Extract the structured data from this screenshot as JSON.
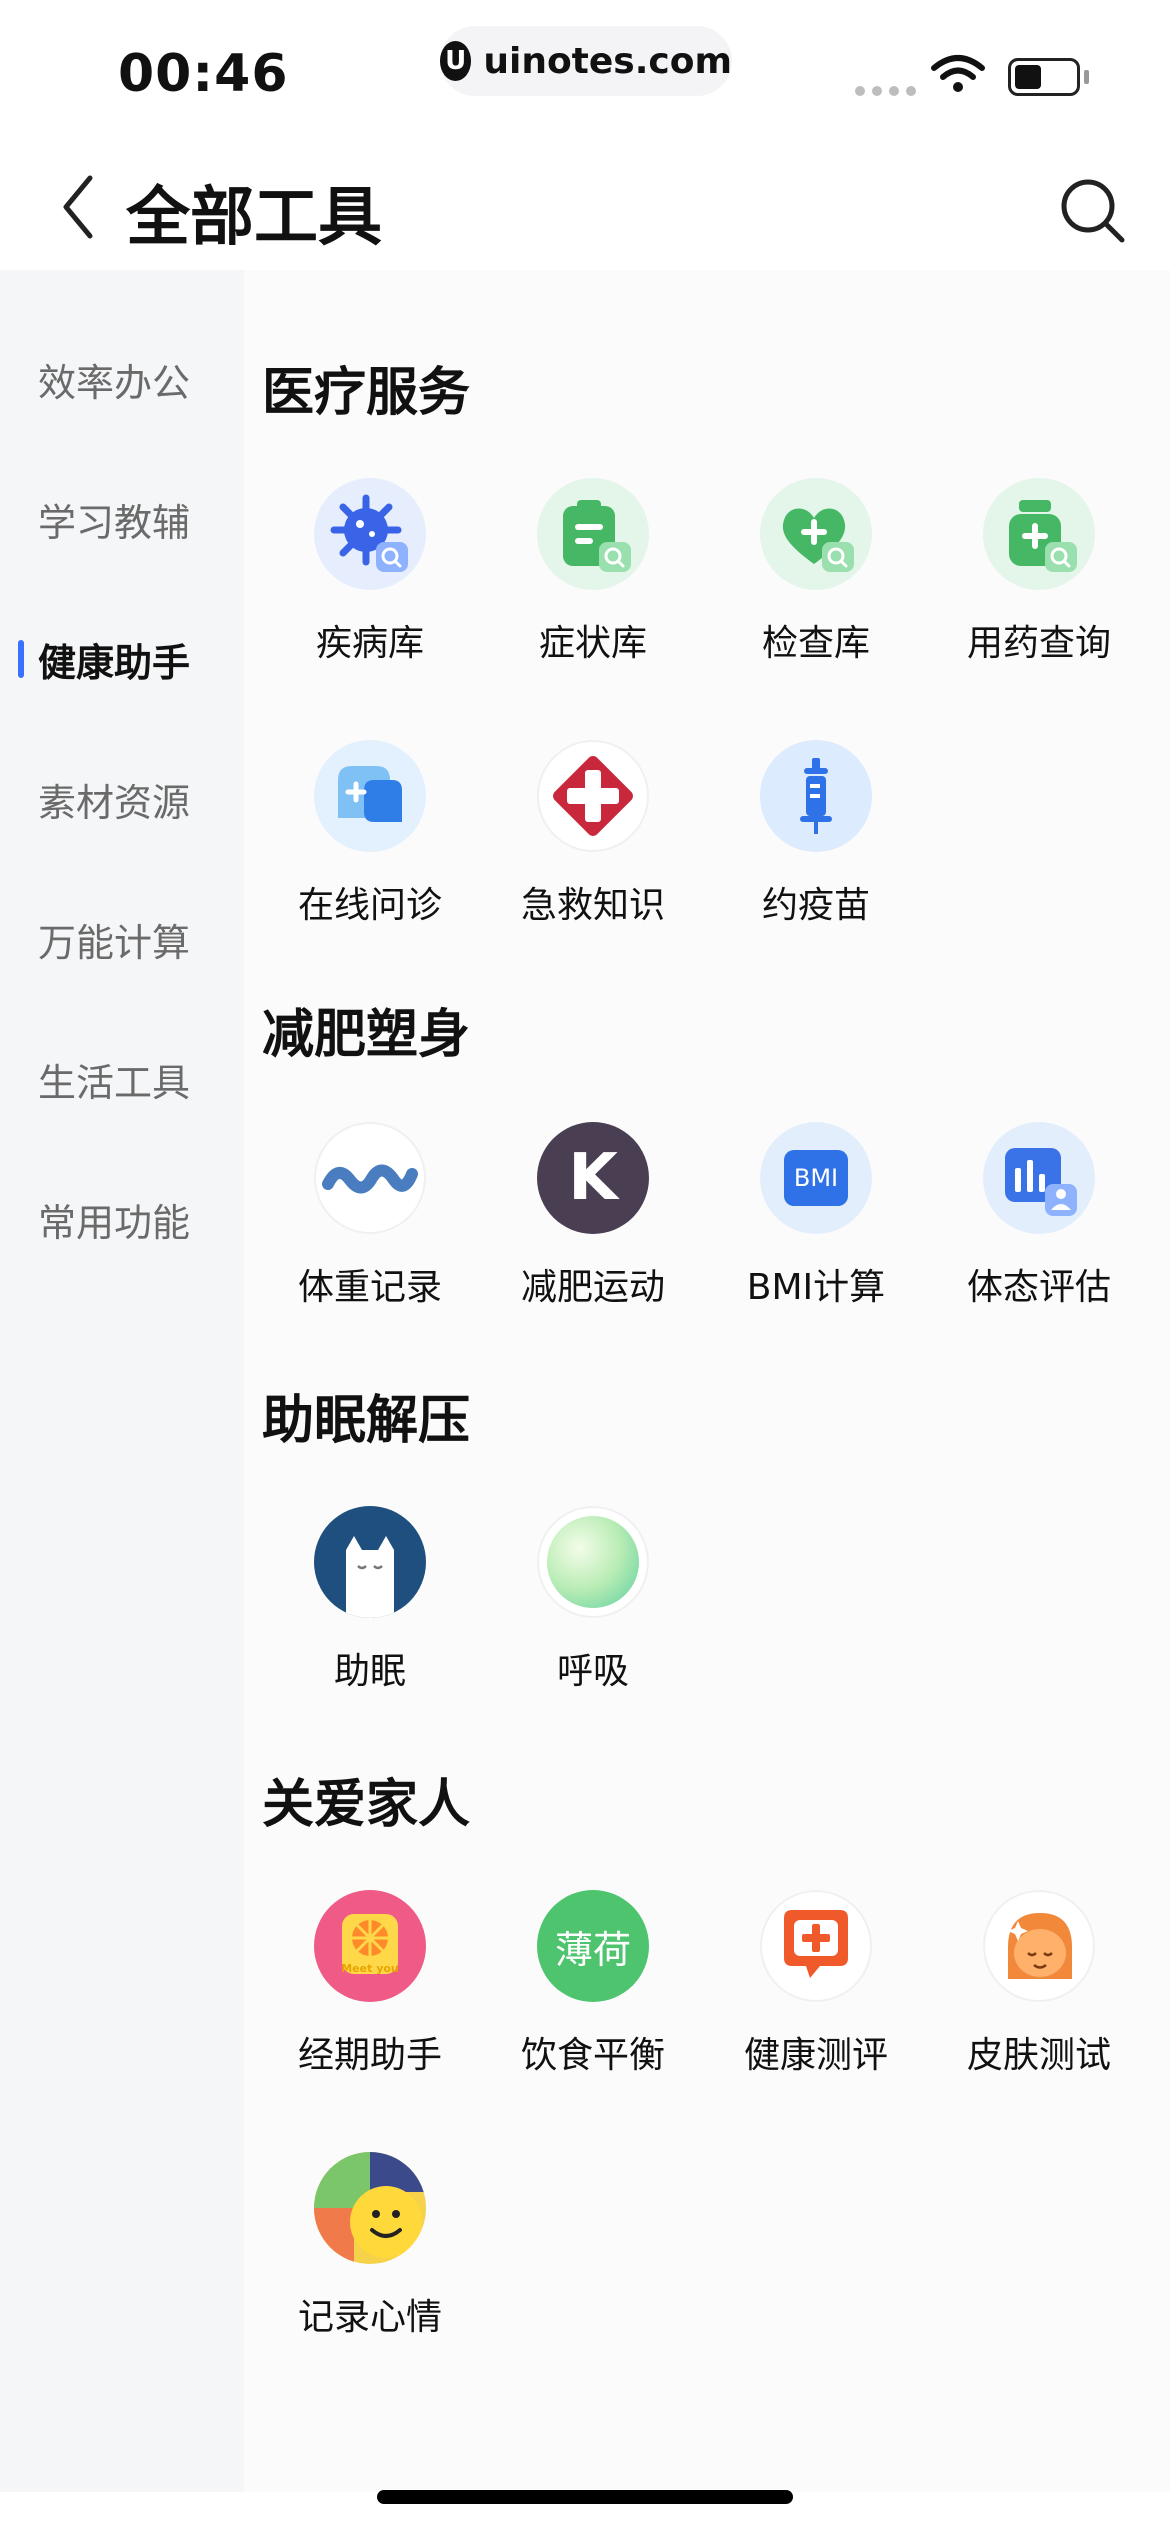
{
  "status_bar": {
    "time": "00:46",
    "url_logo": "U",
    "url": "uinotes.com"
  },
  "header": {
    "title": "全部工具",
    "back_icon": "chevron-left-icon",
    "search_icon": "search-icon"
  },
  "sidebar": {
    "items": [
      {
        "label": "效率办公",
        "active": false
      },
      {
        "label": "学习教辅",
        "active": false
      },
      {
        "label": "健康助手",
        "active": true
      },
      {
        "label": "素材资源",
        "active": false
      },
      {
        "label": "万能计算",
        "active": false
      },
      {
        "label": "生活工具",
        "active": false
      },
      {
        "label": "常用功能",
        "active": false
      }
    ]
  },
  "sections": [
    {
      "title": "医疗服务",
      "tools": [
        {
          "label": "疾病库",
          "icon": "virus-search-icon"
        },
        {
          "label": "症状库",
          "icon": "clipboard-search-icon"
        },
        {
          "label": "检查库",
          "icon": "heart-plus-search-icon"
        },
        {
          "label": "用药查询",
          "icon": "medicine-bottle-search-icon"
        },
        {
          "label": "在线问诊",
          "icon": "chat-plus-icon"
        },
        {
          "label": "急救知识",
          "icon": "first-aid-cross-icon"
        },
        {
          "label": "约疫苗",
          "icon": "syringe-icon"
        }
      ]
    },
    {
      "title": "减肥塑身",
      "tools": [
        {
          "label": "体重记录",
          "icon": "wave-line-icon"
        },
        {
          "label": "减肥运动",
          "icon": "keep-k-icon",
          "icon_text": "K"
        },
        {
          "label": "BMI计算",
          "icon": "bmi-badge-icon",
          "icon_text": "BMI"
        },
        {
          "label": "体态评估",
          "icon": "bar-chart-person-icon"
        }
      ]
    },
    {
      "title": "助眠解压",
      "tools": [
        {
          "label": "助眠",
          "icon": "sleeping-cat-icon"
        },
        {
          "label": "呼吸",
          "icon": "breath-orb-icon"
        }
      ]
    },
    {
      "title": "关爱家人",
      "tools": [
        {
          "label": "经期助手",
          "icon": "grapefruit-meetyou-icon",
          "icon_text": "Meet you"
        },
        {
          "label": "饮食平衡",
          "icon": "bohe-leaf-icon",
          "icon_text": "薄荷"
        },
        {
          "label": "健康测评",
          "icon": "chat-cross-icon"
        },
        {
          "label": "皮肤测试",
          "icon": "face-sparkle-icon"
        },
        {
          "label": "记录心情",
          "icon": "mood-faces-icon"
        }
      ]
    }
  ],
  "colors": {
    "accent": "#3a72ff",
    "sidebar_bg": "#f5f6f8",
    "content_bg": "#fbfbfc"
  }
}
